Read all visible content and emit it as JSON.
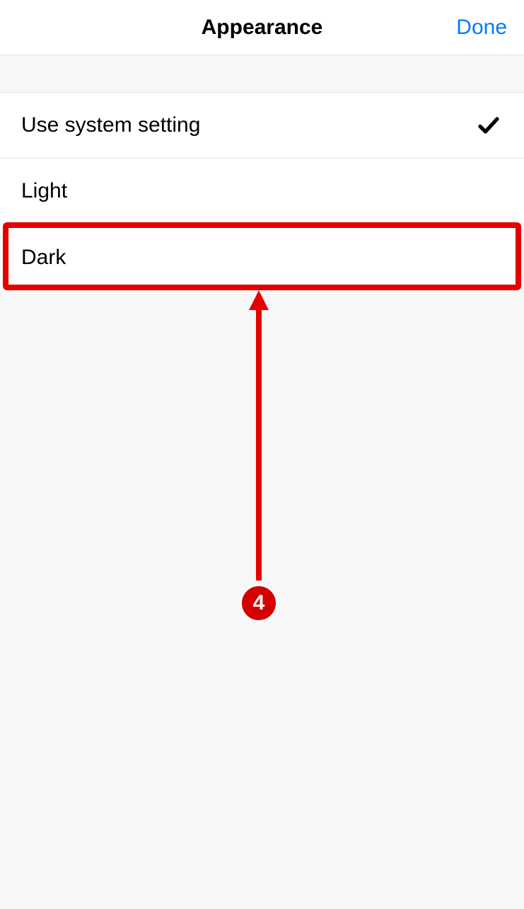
{
  "header": {
    "title": "Appearance",
    "done_label": "Done"
  },
  "options": [
    {
      "label": "Use system setting",
      "selected": true
    },
    {
      "label": "Light",
      "selected": false
    },
    {
      "label": "Dark",
      "selected": false
    }
  ],
  "annotation": {
    "badge_number": "4",
    "highlight_color": "#e60000"
  }
}
